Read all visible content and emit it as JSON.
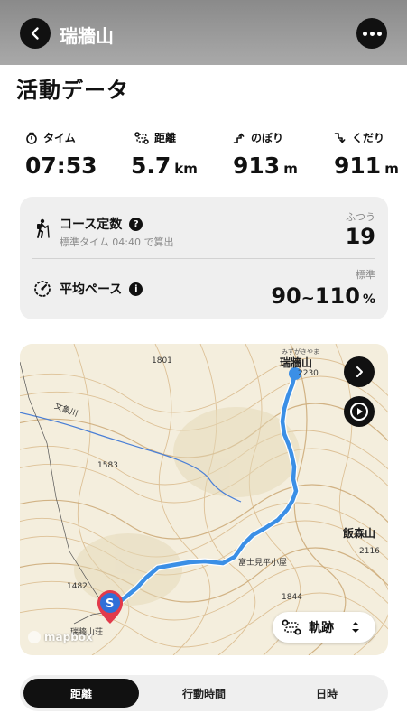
{
  "header": {
    "title": "瑞牆山"
  },
  "section_title": "活動データ",
  "stats": [
    {
      "label": "タイム",
      "value": "07:53",
      "unit": "",
      "icon": "stopwatch-icon"
    },
    {
      "label": "距離",
      "value": "5.7",
      "unit": "km",
      "icon": "route-icon"
    },
    {
      "label": "のぼり",
      "value": "913",
      "unit": "m",
      "icon": "ascent-icon"
    },
    {
      "label": "くだり",
      "value": "911",
      "unit": "m",
      "icon": "descent-icon"
    }
  ],
  "course": {
    "title": "コース定数",
    "subtitle": "標準タイム 04:40 で算出",
    "rating_label": "ふつう",
    "value": "19"
  },
  "pace": {
    "title": "平均ペース",
    "rating_label": "標準",
    "value_low": "90",
    "tilde": "~",
    "value_high": "110",
    "unit": "%"
  },
  "map": {
    "peak_name": "瑞牆山",
    "peak_kana": "みずがきやま",
    "labels": [
      "1801",
      "文象川",
      "1583",
      "1482",
      "富士見平小屋",
      "飯森山",
      "2116",
      "1844",
      "瑞牆山荘",
      "2230"
    ],
    "track_label": "軌跡",
    "start_marker": "S",
    "attribution": "mapbox",
    "track_color": "#3b8fe6",
    "marker_color": "#e23a4b"
  },
  "tabs": [
    {
      "label": "距離",
      "active": true
    },
    {
      "label": "行動時間",
      "active": false
    },
    {
      "label": "日時",
      "active": false
    }
  ]
}
